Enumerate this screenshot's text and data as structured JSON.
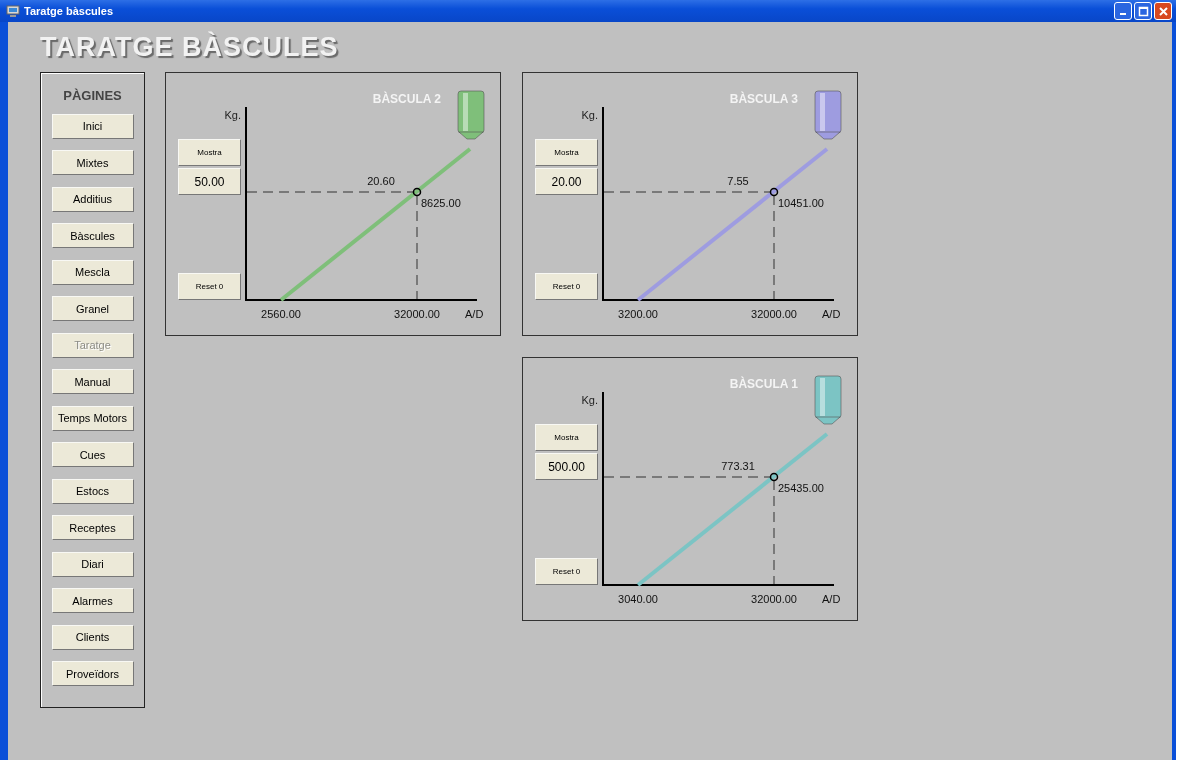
{
  "window": {
    "title": "Taratge bàscules"
  },
  "heading": "TARATGE BÀSCULES",
  "sidebar": {
    "title": "PÀGINES",
    "items": [
      {
        "label": "Inici",
        "selected": false
      },
      {
        "label": "Mixtes",
        "selected": false
      },
      {
        "label": "Additius",
        "selected": false
      },
      {
        "label": "Bàscules",
        "selected": false
      },
      {
        "label": "Mescla",
        "selected": false
      },
      {
        "label": "Granel",
        "selected": false
      },
      {
        "label": "Taratge",
        "selected": true
      },
      {
        "label": "Manual",
        "selected": false
      },
      {
        "label": "Temps Motors",
        "selected": false
      },
      {
        "label": "Cues",
        "selected": false
      },
      {
        "label": "Estocs",
        "selected": false
      },
      {
        "label": "Receptes",
        "selected": false
      },
      {
        "label": "Diari",
        "selected": false
      },
      {
        "label": "Alarmes",
        "selected": false
      },
      {
        "label": "Clients",
        "selected": false
      },
      {
        "label": "Proveïdors",
        "selected": false
      }
    ]
  },
  "scales": [
    {
      "title": "BÀSCULA 2",
      "color": "#7fbf7a",
      "y_unit": "Kg.",
      "sample_button": "Mostra",
      "sample_value": "50.00",
      "reset_button": "Reset 0",
      "point_value": "20.60",
      "point_ad": "8625.00",
      "x_start": "2560.00",
      "x_end": "32000.00",
      "x_unit": "A/D"
    },
    {
      "title": "BÀSCULA 3",
      "color": "#9e9ce0",
      "y_unit": "Kg.",
      "sample_button": "Mostra",
      "sample_value": "20.00",
      "reset_button": "Reset 0",
      "point_value": "7.55",
      "point_ad": "10451.00",
      "x_start": "3200.00",
      "x_end": "32000.00",
      "x_unit": "A/D"
    },
    {
      "title": "BÀSCULA 1",
      "color": "#7cc4c4",
      "y_unit": "Kg.",
      "sample_button": "Mostra",
      "sample_value": "500.00",
      "reset_button": "Reset 0",
      "point_value": "773.31",
      "point_ad": "25435.00",
      "x_start": "3040.00",
      "x_end": "32000.00",
      "x_unit": "A/D"
    }
  ]
}
